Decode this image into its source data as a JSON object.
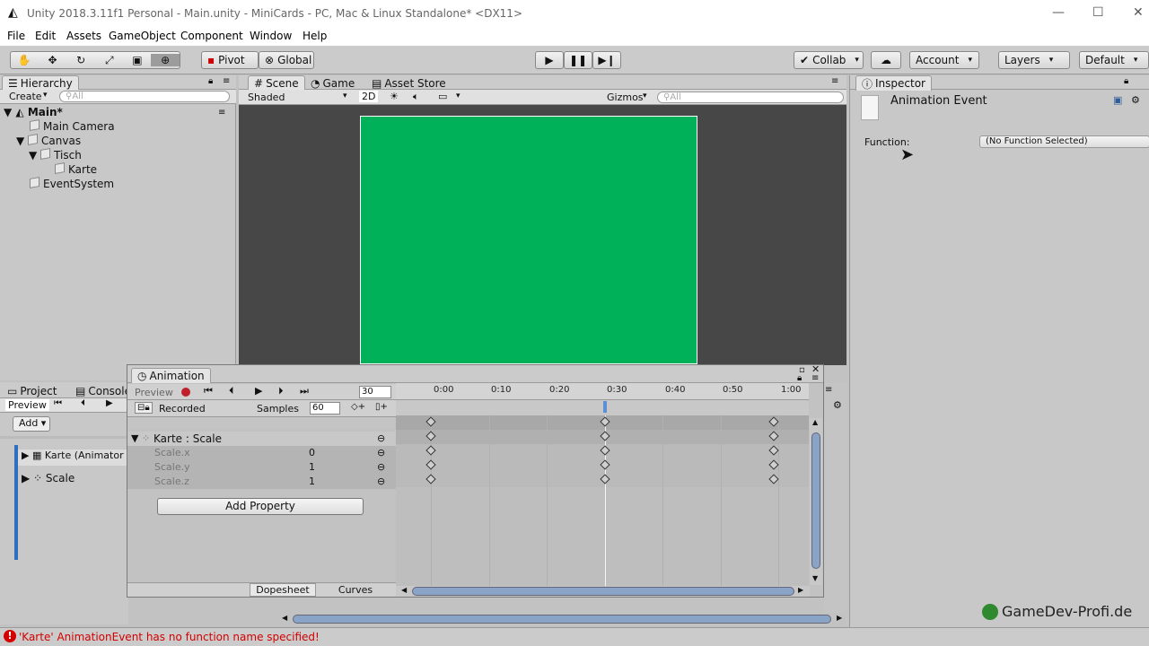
{
  "window": {
    "title": "Unity 2018.3.11f1 Personal - Main.unity - MiniCards - PC, Mac & Linux Standalone* <DX11>",
    "minimize": "—",
    "maximize": "☐",
    "close": "✕"
  },
  "menu": [
    "File",
    "Edit",
    "Assets",
    "GameObject",
    "Component",
    "Window",
    "Help"
  ],
  "toolbar": {
    "pivot": "Pivot",
    "global": "Global",
    "collab": "Collab",
    "account": "Account",
    "layers": "Layers",
    "layout": "Default"
  },
  "hierarchy": {
    "tab": "Hierarchy",
    "create": "Create",
    "search_placeholder": "All",
    "items": [
      "Main*",
      "Main Camera",
      "Canvas",
      "Tisch",
      "Karte",
      "EventSystem"
    ]
  },
  "scene": {
    "tabs": [
      "Scene",
      "Game",
      "Asset Store"
    ],
    "shading": "Shaded",
    "mode2d": "2D",
    "gizmos": "Gizmos",
    "search_placeholder": "All",
    "bg_color": "#474747",
    "canvas_color": "#00b159"
  },
  "inspector": {
    "tab": "Inspector",
    "object_name": "Animation Event",
    "function_label": "Function:",
    "function_value": "(No Function Selected)"
  },
  "project": {
    "tabs": [
      "Project",
      "Console"
    ],
    "preview": "Preview",
    "add": "Add",
    "items": [
      "Karte (Animator",
      "Scale"
    ]
  },
  "animation": {
    "tab": "Animation",
    "preview": "Preview",
    "frame": "30",
    "recorded": "Recorded",
    "samples_label": "Samples",
    "samples_value": "60",
    "timeline_ticks": [
      "0:00",
      "0:10",
      "0:20",
      "0:30",
      "0:40",
      "0:50",
      "1:00"
    ],
    "group": "Karte : Scale",
    "properties": [
      {
        "name": "Scale.x",
        "value": "0"
      },
      {
        "name": "Scale.y",
        "value": "1"
      },
      {
        "name": "Scale.z",
        "value": "1"
      }
    ],
    "add_property": "Add Property",
    "view_tabs": [
      "Dopesheet",
      "Curves"
    ]
  },
  "status": {
    "message": "'Karte' AnimationEvent has no function name specified!",
    "error_color": "#d40000"
  },
  "watermark": "GameDev-Profi.de"
}
